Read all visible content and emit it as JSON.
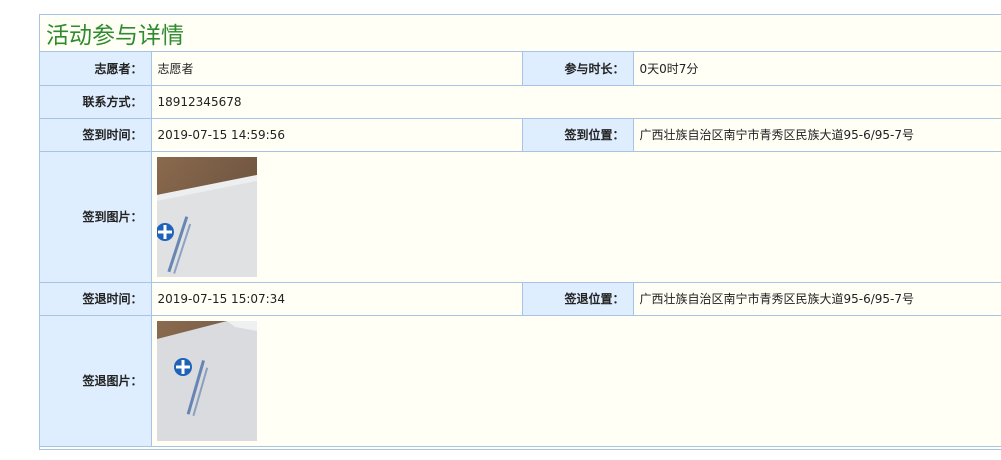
{
  "page_title": "活动参与详情",
  "rows": {
    "volunteer": {
      "label": "志愿者：",
      "value": "志愿者"
    },
    "duration": {
      "label": "参与时长：",
      "value": "0天0时7分"
    },
    "contact": {
      "label": "联系方式：",
      "value": "18912345678"
    },
    "checkin_time": {
      "label": "签到时间：",
      "value": "2019-07-15 14:59:56"
    },
    "checkin_location": {
      "label": "签到位置：",
      "value": "广西壮族自治区南宁市青秀区民族大道95-6/95-7号"
    },
    "checkin_photo": {
      "label": "签到图片："
    },
    "checkout_time": {
      "label": "签退时间：",
      "value": "2019-07-15 15:07:34"
    },
    "checkout_location": {
      "label": "签退位置：",
      "value": "广西壮族自治区南宁市青秀区民族大道95-6/95-7号"
    },
    "checkout_photo": {
      "label": "签退图片："
    }
  },
  "colors": {
    "title": "#2e8b2e",
    "label_bg": "#dfeefe",
    "border": "#a8c4e4",
    "panel_bg": "#fffff6"
  }
}
